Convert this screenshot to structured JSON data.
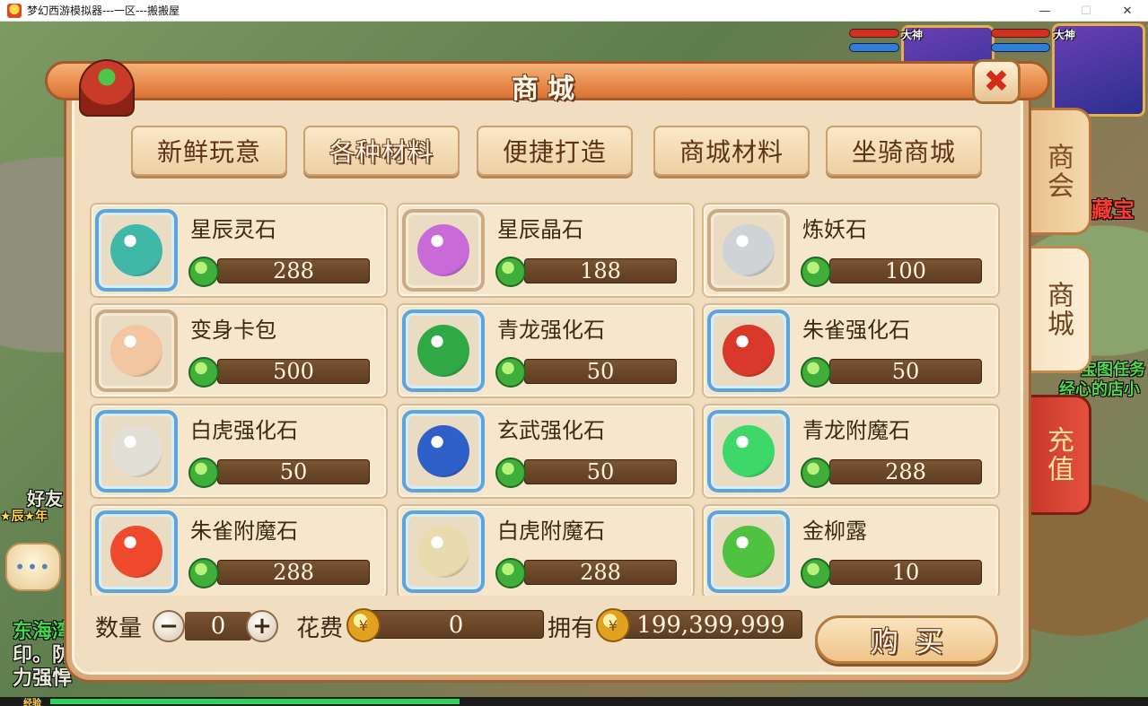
{
  "window": {
    "title": "梦幻西游模拟器---一区---搬搬屋",
    "minimize": "—",
    "maximize": "☐",
    "close": "✕"
  },
  "scene": {
    "left_labels": [
      "好友",
      "★辰★年",
      "东海湾",
      "印。防",
      "力强悍"
    ],
    "right_labels": [
      "藏宝",
      "宝图任务",
      "经心的店小"
    ],
    "chat_icon": "chat-bubble-icon",
    "player_badge": "大神",
    "exp_label": "经验",
    "exp_progress": 0.38
  },
  "side_tabs": {
    "shanghui": "商会",
    "shangcheng": "商城",
    "chongzhi": "充值"
  },
  "shop": {
    "title": "商城",
    "close_symbol": "✖",
    "categories": [
      {
        "label": "新鲜玩意",
        "active": false
      },
      {
        "label": "各种材料",
        "active": true
      },
      {
        "label": "便捷打造",
        "active": false
      },
      {
        "label": "商城材料",
        "active": false
      },
      {
        "label": "坐骑商城",
        "active": false
      }
    ],
    "items": [
      {
        "name": "星辰灵石",
        "price": "288",
        "icon": "blue-green-crystals-icon",
        "color": "#3fb8a8"
      },
      {
        "name": "星辰晶石",
        "price": "188",
        "icon": "rainbow-crystals-icon",
        "color": "#c86ad8"
      },
      {
        "name": "炼妖石",
        "price": "100",
        "icon": "silver-stone-icon",
        "color": "#cfd3d6"
      },
      {
        "name": "变身卡包",
        "price": "500",
        "icon": "card-pouch-icon",
        "color": "#f2c6a0"
      },
      {
        "name": "青龙强化石",
        "price": "50",
        "icon": "green-dragon-stone-icon",
        "color": "#2fa846"
      },
      {
        "name": "朱雀强化石",
        "price": "50",
        "icon": "red-phoenix-stone-icon",
        "color": "#d8392a"
      },
      {
        "name": "白虎强化石",
        "price": "50",
        "icon": "white-tiger-stone-icon",
        "color": "#e2dfd6"
      },
      {
        "name": "玄武强化石",
        "price": "50",
        "icon": "black-tortoise-stone-icon",
        "color": "#2f5fc8"
      },
      {
        "name": "青龙附魔石",
        "price": "288",
        "icon": "green-dragon-enchant-icon",
        "color": "#3ed86a"
      },
      {
        "name": "朱雀附魔石",
        "price": "288",
        "icon": "red-phoenix-enchant-icon",
        "color": "#f04a2e"
      },
      {
        "name": "白虎附魔石",
        "price": "288",
        "icon": "white-tiger-enchant-icon",
        "color": "#e8dcae"
      },
      {
        "name": "金柳露",
        "price": "10",
        "icon": "green-gourd-icon",
        "color": "#4fc23f"
      }
    ],
    "quantity_label": "数量",
    "quantity_value": "0",
    "minus": "−",
    "plus": "+",
    "cost_label": "花费",
    "cost_value": "0",
    "owned_label": "拥有",
    "owned_value": "199,399,999",
    "buy_label": "购买"
  }
}
